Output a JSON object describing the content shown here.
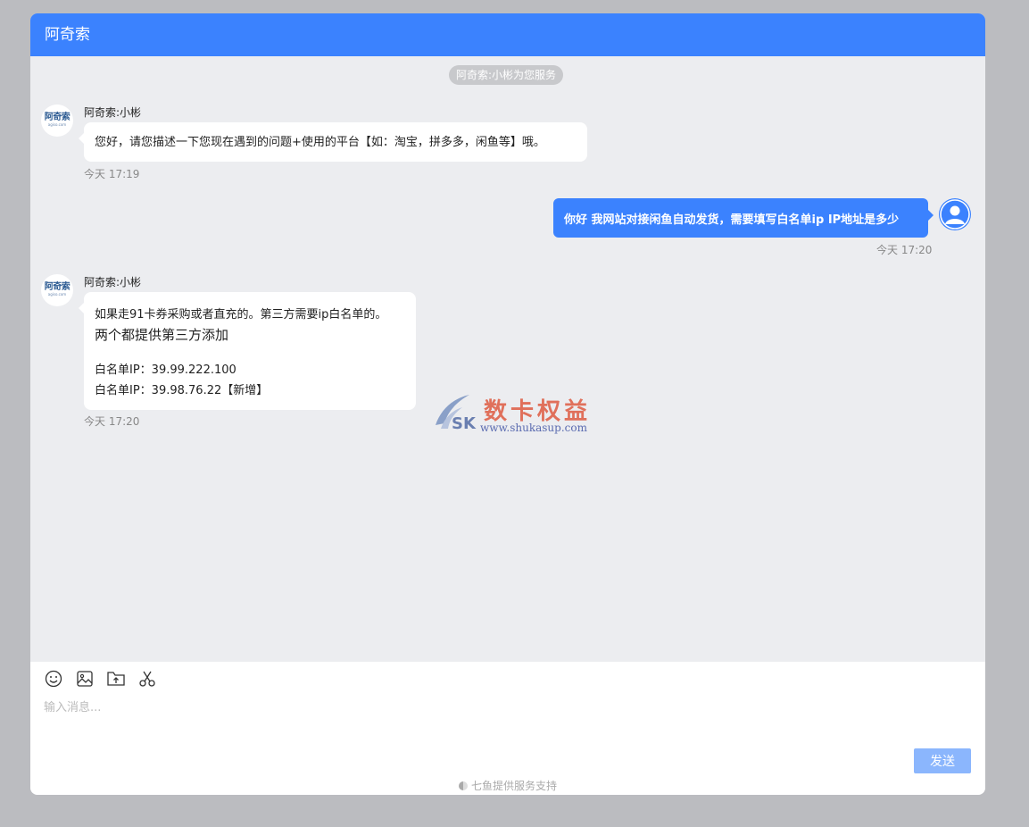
{
  "header": {
    "title": "阿奇索"
  },
  "system_notice": "阿奇索:小彬为您服务",
  "brand_avatar": {
    "text": "阿奇索",
    "subtext": "agiso.com"
  },
  "messages": [
    {
      "sender": "阿奇索:小彬",
      "lines": [
        "您好，请您描述一下您现在遇到的问题+使用的平台【如：淘宝，拼多多，闲鱼等】哦。"
      ],
      "time": "今天 17:19"
    },
    {
      "lines": [
        "你好 我网站对接闲鱼自动发货，需要填写白名单ip IP地址是多少"
      ],
      "time": "今天 17:20"
    },
    {
      "sender": "阿奇索:小彬",
      "lines": [
        "如果走91卡券采购或者直充的。第三方需要ip白名单的。",
        "两个都提供第三方添加",
        "白名单IP：39.99.222.100",
        "白名单IP：39.98.76.22【新增】"
      ],
      "time": "今天 17:20"
    }
  ],
  "watermark": {
    "logo": "SK",
    "text": "数卡权益",
    "url": "www.shukasup.com"
  },
  "composer": {
    "placeholder": "输入消息...",
    "send_label": "发送",
    "tools": [
      "emoji-icon",
      "image-icon",
      "upload-file-icon",
      "scissors-icon"
    ]
  },
  "footer": {
    "text": "七鱼提供服务支持"
  },
  "colors": {
    "accent": "#3b82fe",
    "send_button": "#8bb6fd",
    "background": "#ecedf0"
  }
}
